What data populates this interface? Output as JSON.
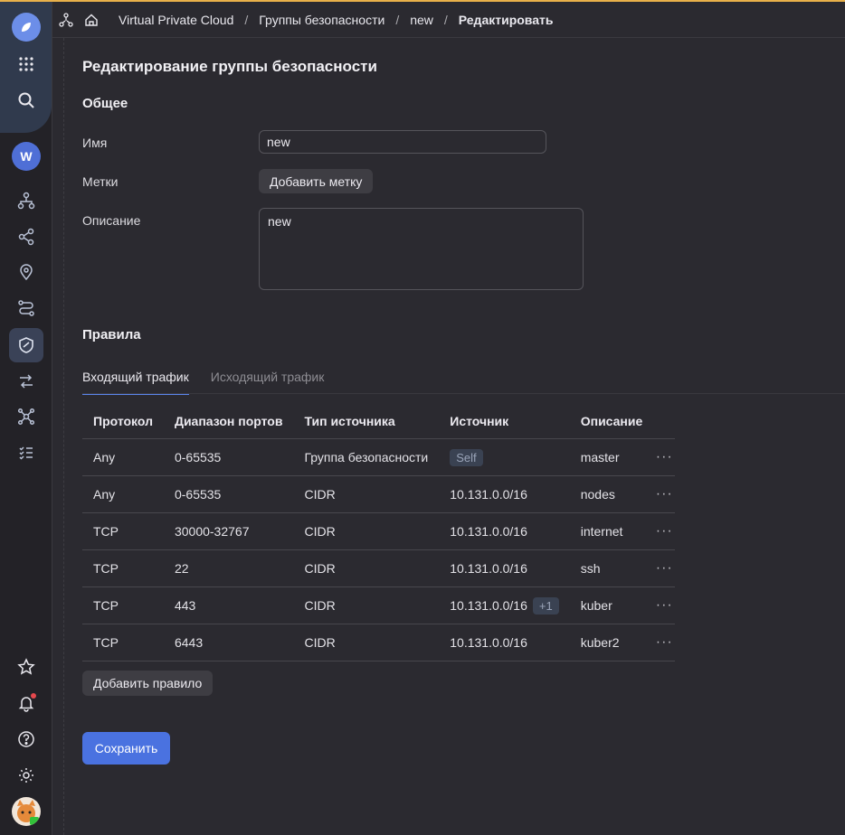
{
  "breadcrumb": {
    "items": [
      "Virtual Private Cloud",
      "Группы безопасности",
      "new"
    ],
    "current": "Редактировать",
    "separator": "/"
  },
  "page": {
    "title": "Редактирование группы безопасности"
  },
  "general": {
    "title": "Общее",
    "name_label": "Имя",
    "name_value": "new",
    "labels_label": "Метки",
    "add_label_button": "Добавить метку",
    "description_label": "Описание",
    "description_value": "new"
  },
  "rules": {
    "title": "Правила",
    "tabs": [
      "Входящий трафик",
      "Исходящий трафик"
    ],
    "active_tab": 0,
    "columns": [
      "Протокол",
      "Диапазон портов",
      "Тип источника",
      "Источник",
      "Описание"
    ],
    "rows": [
      {
        "protocol": "Any",
        "ports": "0-65535",
        "source_type": "Группа безопасности",
        "source": "Self",
        "source_tag": true,
        "extra": "",
        "description": "master"
      },
      {
        "protocol": "Any",
        "ports": "0-65535",
        "source_type": "CIDR",
        "source": "10.131.0.0/16",
        "source_tag": false,
        "extra": "",
        "description": "nodes"
      },
      {
        "protocol": "TCP",
        "ports": "30000-32767",
        "source_type": "CIDR",
        "source": "10.131.0.0/16",
        "source_tag": false,
        "extra": "",
        "description": "internet"
      },
      {
        "protocol": "TCP",
        "ports": "22",
        "source_type": "CIDR",
        "source": "10.131.0.0/16",
        "source_tag": false,
        "extra": "",
        "description": "ssh"
      },
      {
        "protocol": "TCP",
        "ports": "443",
        "source_type": "CIDR",
        "source": "10.131.0.0/16",
        "source_tag": false,
        "extra": "+1",
        "description": "kuber"
      },
      {
        "protocol": "TCP",
        "ports": "6443",
        "source_type": "CIDR",
        "source": "10.131.0.0/16",
        "source_tag": false,
        "extra": "",
        "description": "kuber2"
      }
    ],
    "row_menu": "···",
    "add_rule_button": "Добавить правило"
  },
  "save_button": "Сохранить",
  "folder_avatar": "W",
  "colors": {
    "background": "#2b2a30",
    "accent": "#4a72e0",
    "notification": "#e5484d"
  },
  "sidebar_icons": [
    "apps-grid-icon",
    "search-icon",
    "network-icon",
    "share-nodes-icon",
    "location-pin-icon",
    "route-icon",
    "shield-icon",
    "transfer-arrows-icon",
    "hub-icon",
    "checklist-icon",
    "star-icon",
    "bell-icon",
    "help-icon",
    "gear-icon"
  ]
}
